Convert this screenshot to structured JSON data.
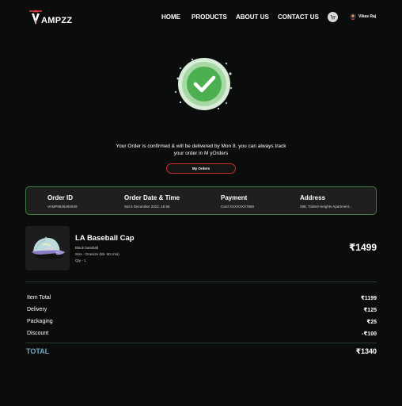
{
  "brand": {
    "logo_text": "AMPZZ"
  },
  "nav": {
    "items": [
      "HOME",
      "PRODUCTS",
      "ABOUT US",
      "CONTACT US"
    ]
  },
  "user": {
    "name": "Vikas Raj"
  },
  "confirmation": {
    "message_line1": "Your Order is confirmed & will be delivered by Mon 8. you can always track",
    "message_line2": "your order in M yOrders",
    "button_label": "My Orders"
  },
  "summary": {
    "order_id_label": "Order ID",
    "order_id": "VAMP6826492949",
    "order_date_label": "Order Date & Time",
    "order_date": "Sat 5 December 2022, 15:56",
    "payment_label": "Payment",
    "payment": "Card XXXXXXX7869",
    "address_label": "Address",
    "address": "298, Trident Heights Apartment..."
  },
  "product": {
    "name": "LA Baseball Cap",
    "description": "Black baseball",
    "size": "Size - Onesize (55- 60 cms)",
    "qty": "Qty - 1",
    "price": "₹1499"
  },
  "totals": {
    "rows": [
      {
        "label": "Item Total",
        "value": "₹1199"
      },
      {
        "label": "Delivery",
        "value": "₹125"
      },
      {
        "label": "Packaging",
        "value": "₹25"
      },
      {
        "label": "Discount",
        "value": "-₹100"
      }
    ],
    "total_label": "TOTAL",
    "total_value": "₹1340"
  },
  "colors": {
    "background": "#0b0c0c",
    "accent_green": "#4caf50",
    "border_red": "#cc2b2b",
    "total_blue": "#6faac9"
  },
  "icons": [
    "vampzz-logo-icon",
    "cart-icon",
    "user-avatar-icon",
    "check-success-icon",
    "baseball-cap-image"
  ]
}
